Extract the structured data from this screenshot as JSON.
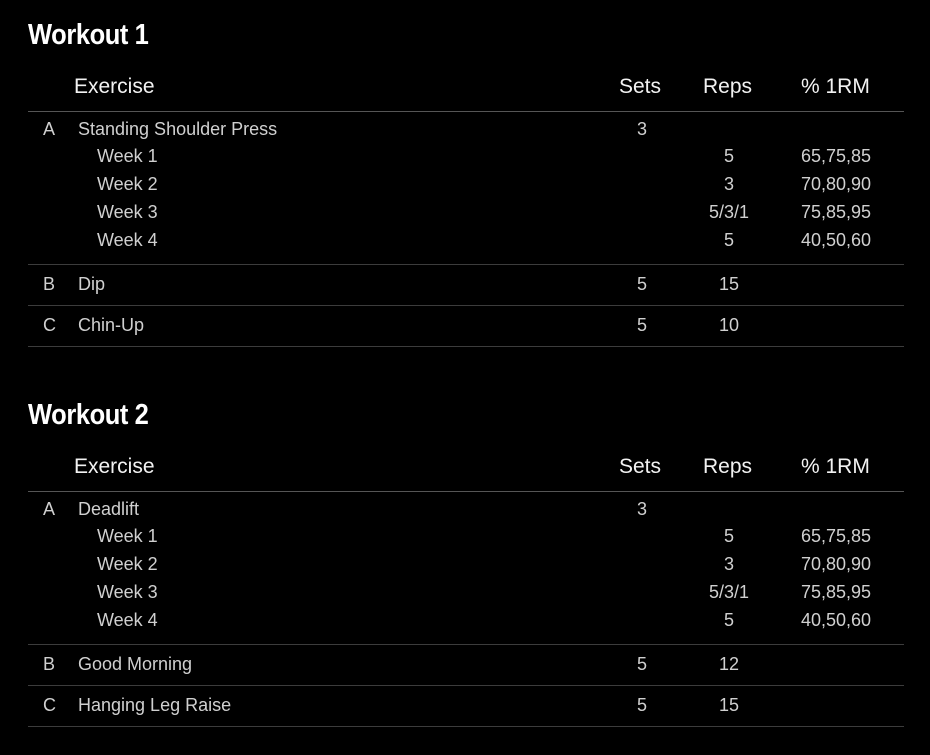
{
  "workouts": [
    {
      "title": "Workout 1",
      "headers": {
        "exercise": "Exercise",
        "sets": "Sets",
        "reps": "Reps",
        "rm": "% 1RM"
      },
      "exercises": [
        {
          "letter": "A",
          "name": "Standing Shoulder Press",
          "sets": "3",
          "weeks": [
            {
              "label": "Week 1",
              "reps": "5",
              "rm": "65,75,85"
            },
            {
              "label": "Week 2",
              "reps": "3",
              "rm": "70,80,90"
            },
            {
              "label": "Week 3",
              "reps": "5/3/1",
              "rm": "75,85,95"
            },
            {
              "label": "Week 4",
              "reps": "5",
              "rm": "40,50,60"
            }
          ]
        },
        {
          "letter": "B",
          "name": "Dip",
          "sets": "5",
          "reps": "15"
        },
        {
          "letter": "C",
          "name": "Chin-Up",
          "sets": "5",
          "reps": "10"
        }
      ]
    },
    {
      "title": "Workout 2",
      "headers": {
        "exercise": "Exercise",
        "sets": "Sets",
        "reps": "Reps",
        "rm": "% 1RM"
      },
      "exercises": [
        {
          "letter": "A",
          "name": "Deadlift",
          "sets": "3",
          "weeks": [
            {
              "label": "Week 1",
              "reps": "5",
              "rm": "65,75,85"
            },
            {
              "label": "Week 2",
              "reps": "3",
              "rm": "70,80,90"
            },
            {
              "label": "Week 3",
              "reps": "5/3/1",
              "rm": "75,85,95"
            },
            {
              "label": "Week 4",
              "reps": "5",
              "rm": "40,50,60"
            }
          ]
        },
        {
          "letter": "B",
          "name": "Good Morning",
          "sets": "5",
          "reps": "12"
        },
        {
          "letter": "C",
          "name": "Hanging Leg Raise",
          "sets": "5",
          "reps": "15"
        }
      ]
    }
  ]
}
